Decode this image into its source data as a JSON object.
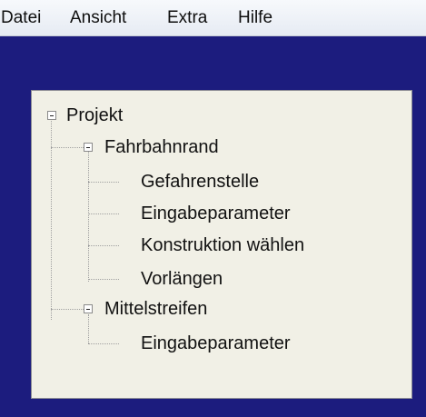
{
  "menu": {
    "items": [
      "Datei",
      "Ansicht",
      "Extra",
      "Hilfe"
    ]
  },
  "tree": {
    "root": "Projekt",
    "groups": [
      {
        "label": "Fahrbahnrand",
        "children": [
          "Gefahrenstelle",
          "Eingabeparameter",
          "Konstruktion wählen",
          "Vorlängen"
        ]
      },
      {
        "label": "Mittelstreifen",
        "children": [
          "Eingabeparameter"
        ]
      }
    ]
  }
}
